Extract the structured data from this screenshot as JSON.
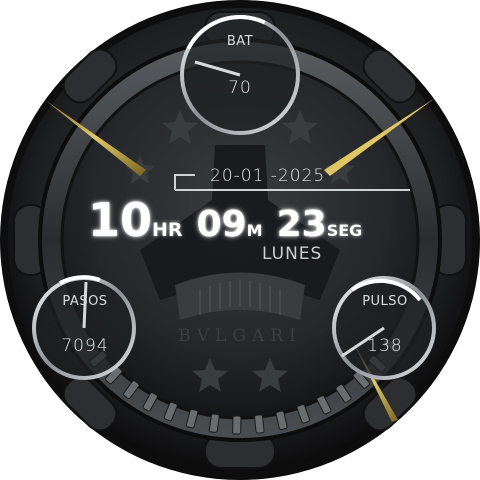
{
  "watch": {
    "brand": "BVLGARI",
    "date": "20-01 -2025",
    "day": "LUNES",
    "hours": "10",
    "hours_unit": "HR",
    "minutes": "09",
    "minutes_unit": "M",
    "seconds": "23",
    "seconds_unit": "SEG"
  },
  "complications": {
    "battery": {
      "label": "BAT",
      "value": "70",
      "level_percent": 70
    },
    "steps": {
      "label": "PASOS",
      "value": "7094"
    },
    "pulse": {
      "label": "PULSO",
      "value": "138"
    }
  },
  "colors": {
    "bezel": "#1c1d1f",
    "dial": "#2a2c2f",
    "accent_gold": "#b59a3a",
    "text": "#ffffff"
  }
}
